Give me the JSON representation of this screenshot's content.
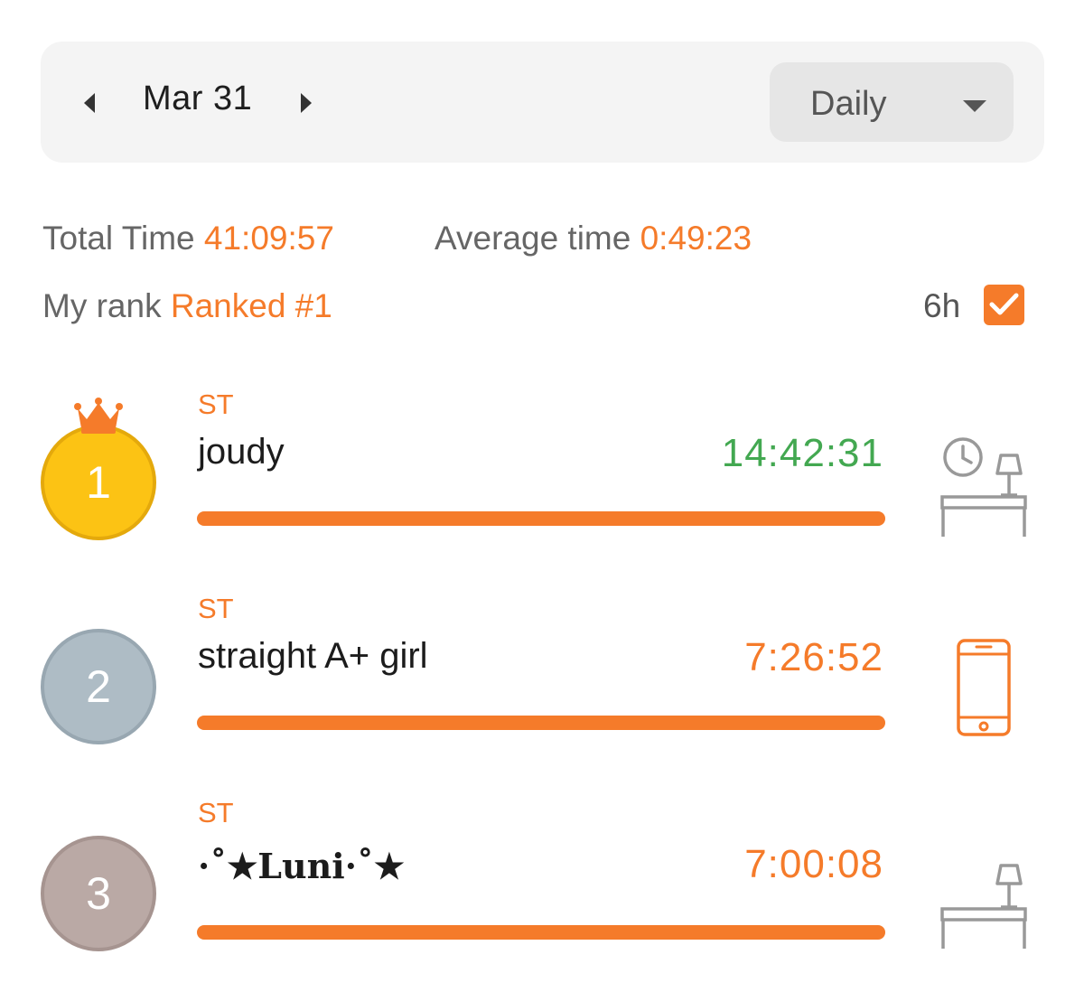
{
  "header": {
    "prev_icon": "caret-left-icon",
    "date": "Mar 31",
    "next_icon": "caret-right-icon",
    "period": "Daily",
    "period_icon": "caret-down-icon"
  },
  "stats": {
    "total_label": "Total Time",
    "total_value": "41:09:57",
    "average_label": "Average time",
    "average_value": "0:49:23",
    "rank_label": "My rank",
    "rank_value": "Ranked #1",
    "hours_label": "6h",
    "hours_checked": true
  },
  "colors": {
    "accent": "#f57b2a",
    "first_time": "#43a851",
    "gold": "#fcc314",
    "silver": "#aebcc5",
    "bronze": "#baa9a5"
  },
  "leaderboard": [
    {
      "rank": "1",
      "tag": "ST",
      "name": "joudy",
      "time": "14:42:31",
      "progress": 1.0,
      "device_icon": "desk-clock-lamp-icon",
      "crown_icon": "crown-icon"
    },
    {
      "rank": "2",
      "tag": "ST",
      "name": "straight A+ girl",
      "time": "7:26:52",
      "progress": 1.0,
      "device_icon": "phone-icon"
    },
    {
      "rank": "3",
      "tag": "ST",
      "name": "·˚★Luni·˚★",
      "time": "7:00:08",
      "progress": 1.0,
      "device_icon": "desk-lamp-icon"
    }
  ]
}
